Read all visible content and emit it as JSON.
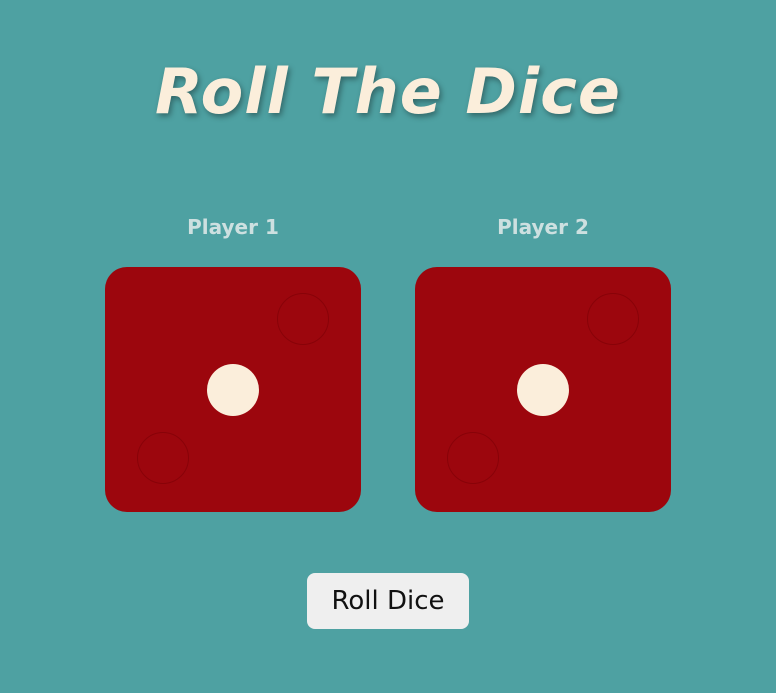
{
  "header": {
    "title": "Roll The Dice"
  },
  "players": [
    {
      "label": "Player 1",
      "die_value": 1
    },
    {
      "label": "Player 2",
      "die_value": 1
    }
  ],
  "controls": {
    "roll_label": "Roll Dice"
  },
  "colors": {
    "background": "#4ea1a2",
    "die_face": "#9c060d",
    "pip": "#fbeedb",
    "title": "#fbeedb",
    "button": "#efefef"
  }
}
